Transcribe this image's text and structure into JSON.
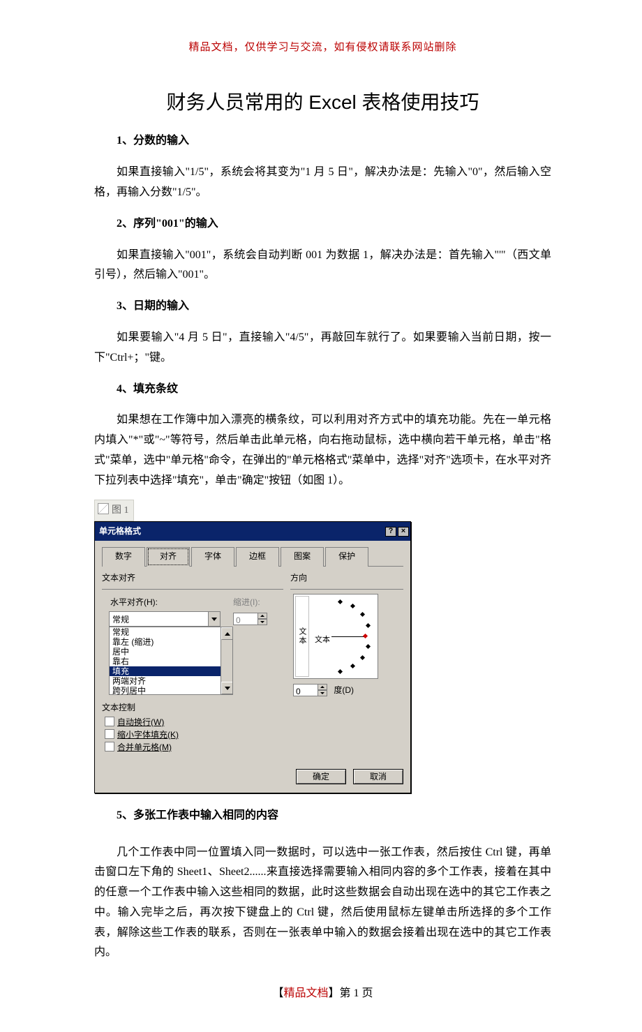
{
  "top_note": "精品文档，仅供学习与交流，如有侵权请联系网站删除",
  "title": "财务人员常用的 Excel 表格使用技巧",
  "sections": {
    "s1": {
      "heading": "1、分数的输入",
      "body": "如果直接输入\"1/5\"，系统会将其变为\"1 月 5 日\"，解决办法是：先输入\"0\"，然后输入空格，再输入分数\"1/5\"。"
    },
    "s2": {
      "heading": "2、序列\"001\"的输入",
      "body": "如果直接输入\"001\"，系统会自动判断 001 为数据 1，解决办法是：首先输入\"'\"（西文单引号），然后输入\"001\"。"
    },
    "s3": {
      "heading": "3、日期的输入",
      "body": "如果要输入\"4 月 5 日\"，直接输入\"4/5\"，再敲回车就行了。如果要输入当前日期，按一下\"Ctrl+；\"键。"
    },
    "s4": {
      "heading": "4、填充条纹",
      "body": "如果想在工作簿中加入漂亮的横条纹，可以利用对齐方式中的填充功能。先在一单元格内填入\"*\"或\"~\"等符号，然后单击此单元格，向右拖动鼠标，选中横向若干单元格，单击\"格式\"菜单，选中\"单元格\"命令，在弹出的\"单元格格式\"菜单中，选择\"对齐\"选项卡，在水平对齐下拉列表中选择\"填充\"，单击\"确定\"按钮（如图 1）。"
    },
    "s5": {
      "heading": "5、多张工作表中输入相同的内容",
      "body": "几个工作表中同一位置填入同一数据时，可以选中一张工作表，然后按住 Ctrl 键，再单击窗口左下角的 Sheet1、Sheet2......来直接选择需要输入相同内容的多个工作表，接着在其中的任意一个工作表中输入这些相同的数据，此时这些数据会自动出现在选中的其它工作表之中。输入完毕之后，再次按下键盘上的 Ctrl 键，然后使用鼠标左键单击所选择的多个工作表，解除这些工作表的联系，否则在一张表单中输入的数据会接着出现在选中的其它工作表内。"
    }
  },
  "figure_label": "图 1",
  "dialog": {
    "title": "单元格格式",
    "help_btn": "?",
    "close_btn": "×",
    "tabs": [
      "数字",
      "对齐",
      "字体",
      "边框",
      "图案",
      "保护"
    ],
    "active_tab_index": 1,
    "text_align_group": "文本对齐",
    "horiz_label": "水平对齐(H):",
    "horiz_value": "常规",
    "horiz_options": [
      "常规",
      "靠左 (缩进)",
      "居中",
      "靠右",
      "填充",
      "两端对齐",
      "跨列居中"
    ],
    "horiz_selected_index": 4,
    "indent_label": "缩进(I):",
    "indent_value": "0",
    "orientation_group": "方向",
    "orientation_text_v": "文本",
    "orientation_text_h": "文本",
    "degree_value": "0",
    "degree_label": "度(D)",
    "text_control_group": "文本控制",
    "chk_wrap": "自动换行(W)",
    "chk_shrink": "缩小字体填充(K)",
    "chk_merge": "合并单元格(M)",
    "ok": "确定",
    "cancel": "取消"
  },
  "footer": {
    "prefix": "【",
    "red": "精品文档",
    "suffix": "】",
    "page_label": "第  1  页"
  }
}
